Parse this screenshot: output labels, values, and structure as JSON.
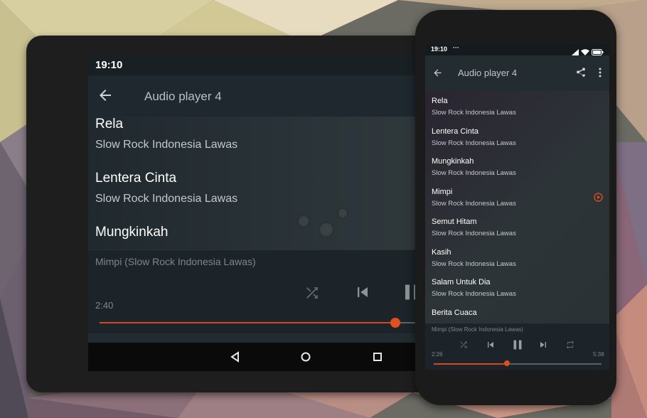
{
  "tablet": {
    "status_time": "19:10",
    "app_title": "Audio player 4",
    "songs": [
      {
        "title": "Rela",
        "artist": "Slow Rock Indonesia Lawas"
      },
      {
        "title": "Lentera Cinta",
        "artist": "Slow Rock Indonesia Lawas"
      },
      {
        "title": "Mungkinkah",
        "artist": ""
      }
    ],
    "now_playing": "Mimpi (Slow Rock Indonesia Lawas)",
    "elapsed": "2:40",
    "progress": 0.88
  },
  "phone": {
    "status_time": "19:10",
    "status_dots": "···",
    "app_title": "Audio player 4",
    "songs": [
      {
        "title": "Rela",
        "artist": "Slow Rock Indonesia Lawas"
      },
      {
        "title": "Lentera Cinta",
        "artist": "Slow Rock Indonesia Lawas"
      },
      {
        "title": "Mungkinkah",
        "artist": "Slow Rock Indonesia Lawas"
      },
      {
        "title": "Mimpi",
        "artist": "Slow Rock Indonesia Lawas",
        "playing": true
      },
      {
        "title": "Semut Hitam",
        "artist": "Slow Rock Indonesia Lawas"
      },
      {
        "title": "Kasih",
        "artist": "Slow Rock Indonesia Lawas"
      },
      {
        "title": "Salam Untuk Dia",
        "artist": "Slow Rock Indonesia Lawas"
      },
      {
        "title": "Berita Cuaca",
        "artist": ""
      }
    ],
    "now_playing": "Mimpi (Slow Rock Indonesia Lawas)",
    "elapsed": "2:26",
    "total": "5:38",
    "progress": 0.43
  },
  "colors": {
    "accent": "#e04f1f",
    "appbar": "#222c31",
    "player_bg": "#1c2429"
  },
  "icons": [
    "arrow-back-icon",
    "share-icon",
    "more-vert-icon",
    "shuffle-icon",
    "skip-previous-icon",
    "pause-icon",
    "skip-next-icon",
    "repeat-icon",
    "play-circle-icon",
    "nav-back-icon",
    "nav-home-icon",
    "nav-recents-icon",
    "signal-icon",
    "wifi-icon",
    "battery-icon"
  ]
}
